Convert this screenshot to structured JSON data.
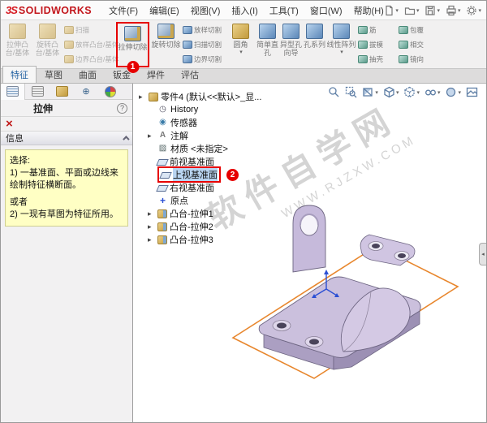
{
  "menubar": {
    "logo_mark": "3S",
    "logo": "SOLIDWORKS",
    "menus": [
      "文件(F)",
      "编辑(E)",
      "视图(V)",
      "插入(I)",
      "工具(T)",
      "窗口(W)",
      "帮助(H)"
    ]
  },
  "ribbon": {
    "buttons": {
      "extrude_boss": "拉伸凸台/基体",
      "revolve_boss": "旋转凸台/基体",
      "sweep": "扫描",
      "loft_boss": "放样凸台/基体",
      "boundary_boss": "边界凸台/基体",
      "extrude_cut": "拉伸切除",
      "revolve_cut": "旋转切除",
      "loft_cut": "放样切割",
      "sweep_cut": "扫描切割",
      "boundary_cut": "边界切割",
      "fillet": "圆角",
      "simple_hole": "简单直孔",
      "hole_wizard": "异型孔向导",
      "hole_series": "孔系列",
      "linear_pattern": "线性阵列",
      "rib": "筋",
      "draft": "拔模",
      "shell": "抽壳",
      "wrap": "包覆",
      "intersect": "相交",
      "mirror": "镜向"
    },
    "callout_1": "1"
  },
  "command_tabs": [
    "特征",
    "草图",
    "曲面",
    "钣金",
    "焊件",
    "评估"
  ],
  "property_panel": {
    "title": "拉伸",
    "help": "?",
    "info_header": "信息",
    "message": {
      "select_label": "选择:",
      "line1": "1) 一基准面、平面或边线来绘制特征横断面。",
      "or_label": "或者",
      "line2": "2) 一现有草图为特征所用。"
    }
  },
  "feature_tree": {
    "items": [
      {
        "label": "零件4 (默认<<默认>_显..."
      },
      {
        "label": "History"
      },
      {
        "label": "传感器"
      },
      {
        "label": "注解"
      },
      {
        "label": "材质 <未指定>"
      },
      {
        "label": "前视基准面"
      },
      {
        "label": "上视基准面"
      },
      {
        "label": "右视基准面"
      },
      {
        "label": "原点"
      },
      {
        "label": "凸台-拉伸1"
      },
      {
        "label": "凸台-拉伸2"
      },
      {
        "label": "凸台-拉伸3"
      }
    ],
    "callout_2": "2"
  },
  "viewport": {
    "watermark_line1": "软件自学网",
    "watermark_line2": "WWW.RJZXW.COM"
  },
  "colors": {
    "accent_red": "#e2231a",
    "highlight_red": "#e60000",
    "selection_blue": "#b9d4f0",
    "plane_orange": "#e8872e",
    "part_lavender": "#cbc0dd",
    "info_yellow": "#ffffc4"
  }
}
